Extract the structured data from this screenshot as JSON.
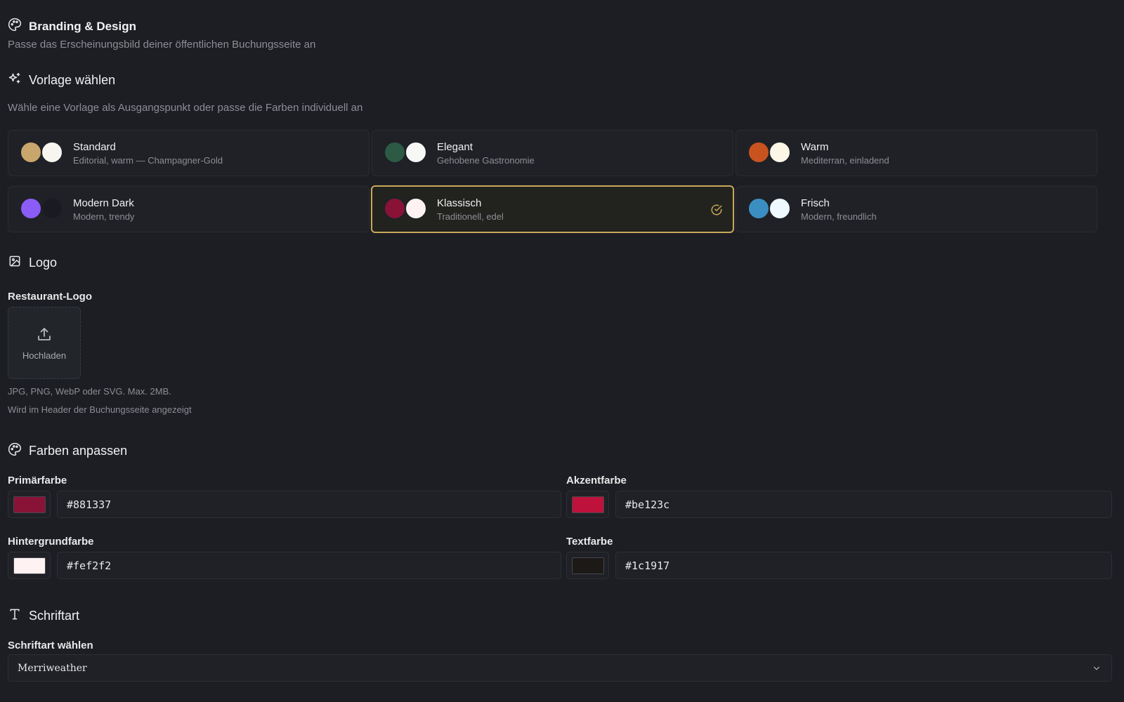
{
  "header": {
    "title": "Branding & Design",
    "subtitle": "Passe das Erscheinungsbild deiner öffentlichen Buchungsseite an",
    "icon": "palette-icon"
  },
  "templates": {
    "title": "Vorlage wählen",
    "icon": "sparkles-icon",
    "hint": "Wähle eine Vorlage als Ausgangspunkt oder passe die Farben individuell an",
    "selected": "Klassisch",
    "items": [
      {
        "name": "Standard",
        "desc": "Editorial, warm — Champagner-Gold",
        "c1": "#c9a66b",
        "c2": "#f7f5f0"
      },
      {
        "name": "Elegant",
        "desc": "Gehobene Gastronomie",
        "c1": "#2d5a45",
        "c2": "#f7f7f5"
      },
      {
        "name": "Warm",
        "desc": "Mediterran, einladend",
        "c1": "#c8531f",
        "c2": "#fbf6e6"
      },
      {
        "name": "Modern Dark",
        "desc": "Modern, trendy",
        "c1": "#8b5cf6",
        "c2": "#1a1b22"
      },
      {
        "name": "Klassisch",
        "desc": "Traditionell, edel",
        "c1": "#881337",
        "c2": "#fef2f2"
      },
      {
        "name": "Frisch",
        "desc": "Modern, freundlich",
        "c1": "#3b8ec2",
        "c2": "#eefaff"
      }
    ]
  },
  "logo": {
    "title": "Logo",
    "icon": "image-icon",
    "field_label": "Restaurant-Logo",
    "upload_label": "Hochladen",
    "upload_icon": "upload-icon",
    "help_formats": "JPG, PNG, WebP oder SVG. Max. 2MB.",
    "help_location": "Wird im Header der Buchungsseite angezeigt"
  },
  "colors": {
    "title": "Farben anpassen",
    "icon": "palette-icon",
    "primary": {
      "label": "Primärfarbe",
      "value": "#881337"
    },
    "accent": {
      "label": "Akzentfarbe",
      "value": "#be123c"
    },
    "background": {
      "label": "Hintergrundfarbe",
      "value": "#fef2f2"
    },
    "text": {
      "label": "Textfarbe",
      "value": "#1c1917"
    }
  },
  "font": {
    "title": "Schriftart",
    "icon": "type-icon",
    "field_label": "Schriftart wählen",
    "value": "Merriweather",
    "chevron_icon": "chevron-down-icon"
  },
  "theme": {
    "accent": "#c9a85a"
  }
}
